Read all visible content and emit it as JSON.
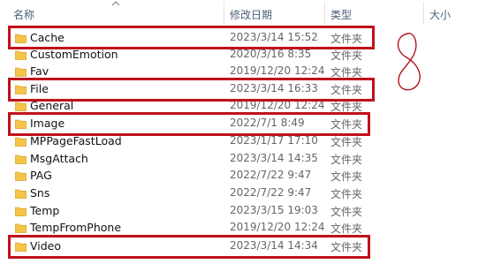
{
  "columns": {
    "name": "名称",
    "modified": "修改日期",
    "type": "类型",
    "size": "大小"
  },
  "files": [
    {
      "name": "Cache",
      "modified": "2023/3/14 15:52",
      "type": "文件夹",
      "highlighted": true
    },
    {
      "name": "CustomEmotion",
      "modified": "2020/3/16 8:35",
      "type": "文件夹",
      "highlighted": false
    },
    {
      "name": "Fav",
      "modified": "2019/12/20 12:24",
      "type": "文件夹",
      "highlighted": false
    },
    {
      "name": "File",
      "modified": "2023/3/14 16:33",
      "type": "文件夹",
      "highlighted": true
    },
    {
      "name": "General",
      "modified": "2019/12/20 12:24",
      "type": "文件夹",
      "highlighted": false
    },
    {
      "name": "Image",
      "modified": "2022/7/1 8:49",
      "type": "文件夹",
      "highlighted": true
    },
    {
      "name": "MPPageFastLoad",
      "modified": "2023/1/17 17:10",
      "type": "文件夹",
      "highlighted": false
    },
    {
      "name": "MsgAttach",
      "modified": "2023/3/14 14:35",
      "type": "文件夹",
      "highlighted": false
    },
    {
      "name": "PAG",
      "modified": "2022/7/22 9:47",
      "type": "文件夹",
      "highlighted": false
    },
    {
      "name": "Sns",
      "modified": "2022/7/22 9:47",
      "type": "文件夹",
      "highlighted": false
    },
    {
      "name": "Temp",
      "modified": "2023/3/15 19:03",
      "type": "文件夹",
      "highlighted": false
    },
    {
      "name": "TempFromPhone",
      "modified": "2019/12/20 12:24",
      "type": "文件夹",
      "highlighted": false
    },
    {
      "name": "Video",
      "modified": "2023/3/14 14:34",
      "type": "文件夹",
      "highlighted": true
    }
  ],
  "icons": {
    "folder": "folder-icon",
    "sort": "sort-up-icon"
  },
  "colors": {
    "folder": "#f5c54a",
    "highlight": "#c0111c",
    "header_text": "#4c607a"
  }
}
